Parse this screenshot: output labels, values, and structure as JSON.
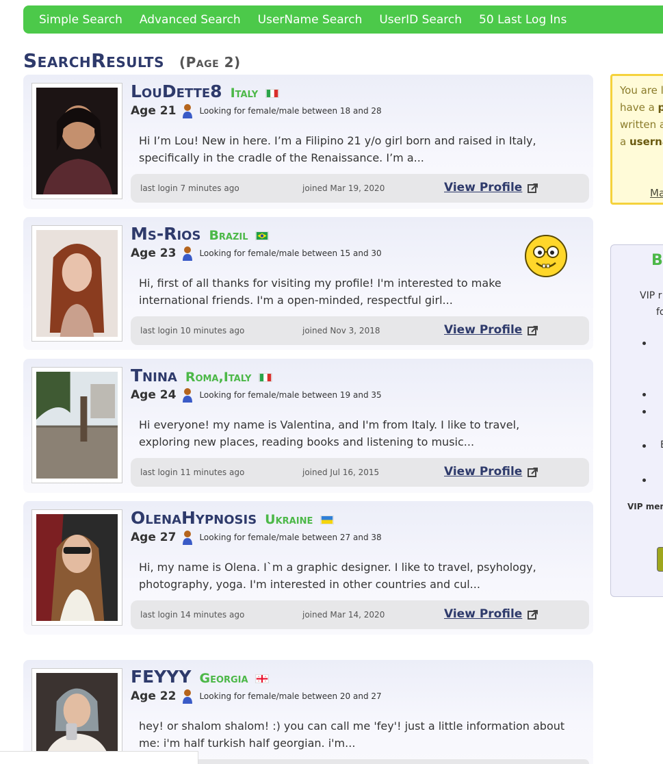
{
  "nav": {
    "items": [
      "Simple Search",
      "Advanced Search",
      "UserName Search",
      "UserID Search",
      "50 Last Log Ins"
    ]
  },
  "heading": {
    "title": "SearchResults",
    "page": "(Page 2)"
  },
  "results": [
    {
      "username": "LouDette8",
      "country": "Italy",
      "flag": "italy",
      "age": "Age 21",
      "looking": "Looking for female/male between 18 and 28",
      "description": "Hi I’m Lou! New in here. I’m a Filipino 21 y/o girl born and raised in Italy, specifically in the cradle of the Renaissance. I’m a...",
      "last_login": "last login 7 minutes ago",
      "joined": "joined Mar 19, 2020",
      "view_profile": "View Profile"
    },
    {
      "username": "Ms-Rios",
      "country": "Brazil",
      "flag": "brazil",
      "age": "Age 23",
      "looking": "Looking for female/male between 15 and 30",
      "description": "Hi, first of all thanks for visiting my profile! I'm interested to make international friends. I'm a open-minded, respectful girl...",
      "last_login": "last login 10 minutes ago",
      "joined": "joined Nov 3, 2018",
      "view_profile": "View Profile"
    },
    {
      "username": "Tnina",
      "country": "Roma,Italy",
      "flag": "italy",
      "age": "Age 24",
      "looking": "Looking for female/male between 19 and 35",
      "description": "Hi everyone! my name is Valentina, and I'm from Italy. I like to travel, exploring new places, reading books and listening to music...",
      "last_login": "last login 11 minutes ago",
      "joined": "joined Jul 16, 2015",
      "view_profile": "View Profile"
    },
    {
      "username": "OlenaHypnosis",
      "country": "Ukraine",
      "flag": "ukraine",
      "age": "Age 27",
      "looking": "Looking for female/male between 27 and 38",
      "description": "Hi, my name is Olena. I`m a graphic designer. I like to travel, psyhology, photography, yoga. I'm interested in other countries and cul...",
      "last_login": "last login 14 minutes ago",
      "joined": "joined Mar 14, 2020",
      "view_profile": "View Profile"
    },
    {
      "username": "FEYYY",
      "country": "Georgia",
      "flag": "georgia",
      "age": "Age 22",
      "looking": "Looking for female/male between 20 and 27",
      "description": "hey! or shalom shalom! :) you can call me 'fey'! just a little information about me: i'm half turkish half georgian. i'm...",
      "last_login": "",
      "joined": "",
      "view_profile": ""
    }
  ],
  "notice": {
    "line1": "You are l",
    "line2_a": "have a ",
    "line2_b": "p",
    "line3": "written a",
    "line4_a": "a ",
    "line4_b": "userna",
    "link": "Ma"
  },
  "vip": {
    "title": "Br",
    "line1": "VIP r",
    "line2": "fo",
    "line3": "E",
    "footer": "VIP mem"
  },
  "colors": {
    "nav_green": "#4cc94a",
    "name_navy": "#2e3a6b",
    "country_green": "#4cb848"
  }
}
